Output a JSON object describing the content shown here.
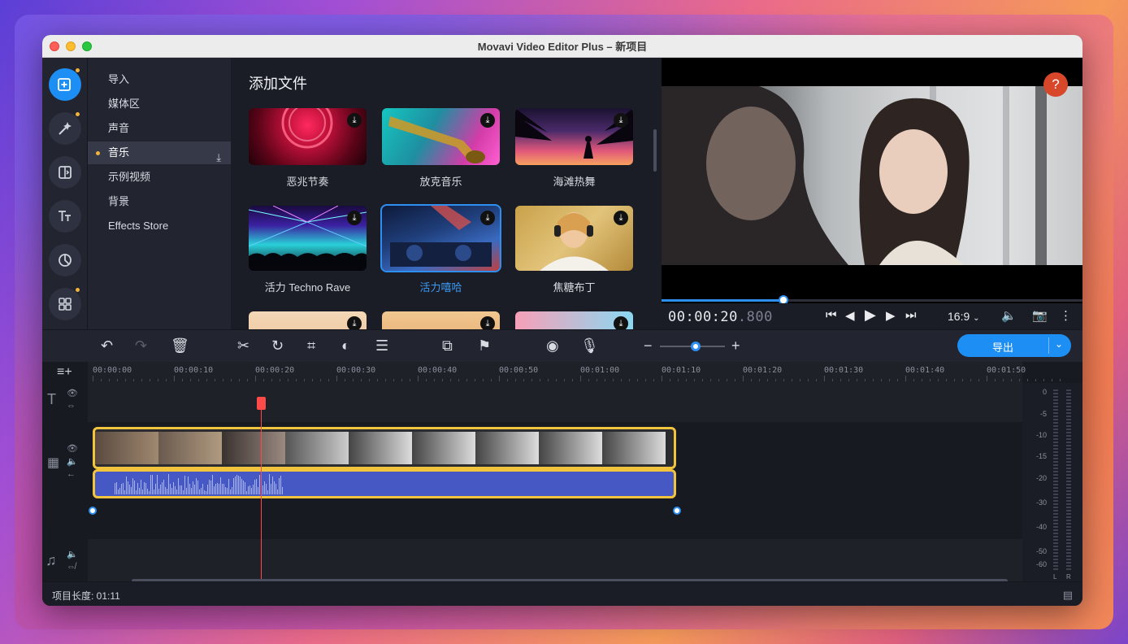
{
  "window": {
    "title": "Movavi Video Editor Plus – 新项目"
  },
  "rail": [
    {
      "icon": "add-file-icon",
      "active": true
    },
    {
      "icon": "magic-wand-icon"
    },
    {
      "icon": "transition-icon"
    },
    {
      "icon": "titles-icon"
    },
    {
      "icon": "sticker-icon"
    },
    {
      "icon": "more-tools-icon"
    }
  ],
  "categories": [
    "导入",
    "媒体区",
    "声音",
    "音乐",
    "示例视频",
    "背景",
    "Effects Store"
  ],
  "media": {
    "heading": "添加文件",
    "tiles": [
      "恶兆节奏",
      "放克音乐",
      "海滩热舞",
      "活力 Techno Rave",
      "活力嘻哈",
      "焦糖布丁"
    ],
    "selected_tile": "活力嘻哈"
  },
  "preview": {
    "help": "?",
    "timecode_main": "00:00:20",
    "timecode_ms": ".800",
    "aspect": "16:9",
    "progress": 0.29
  },
  "toolbar": {
    "export_label": "导出"
  },
  "timeline": {
    "ruler": [
      "00:00:00",
      "00:00:10",
      "00:00:20",
      "00:00:30",
      "00:00:40",
      "00:00:50",
      "00:01:00",
      "00:01:10",
      "00:01:20",
      "00:01:30",
      "00:01:40",
      "00:01:50"
    ],
    "meter_db": [
      "0",
      "-5",
      "-10",
      "-15",
      "-20",
      "-30",
      "-40",
      "-50",
      "-60"
    ],
    "meter_channels": [
      "L",
      "R"
    ]
  },
  "status": {
    "project_length": "项目长度: 01:11"
  }
}
